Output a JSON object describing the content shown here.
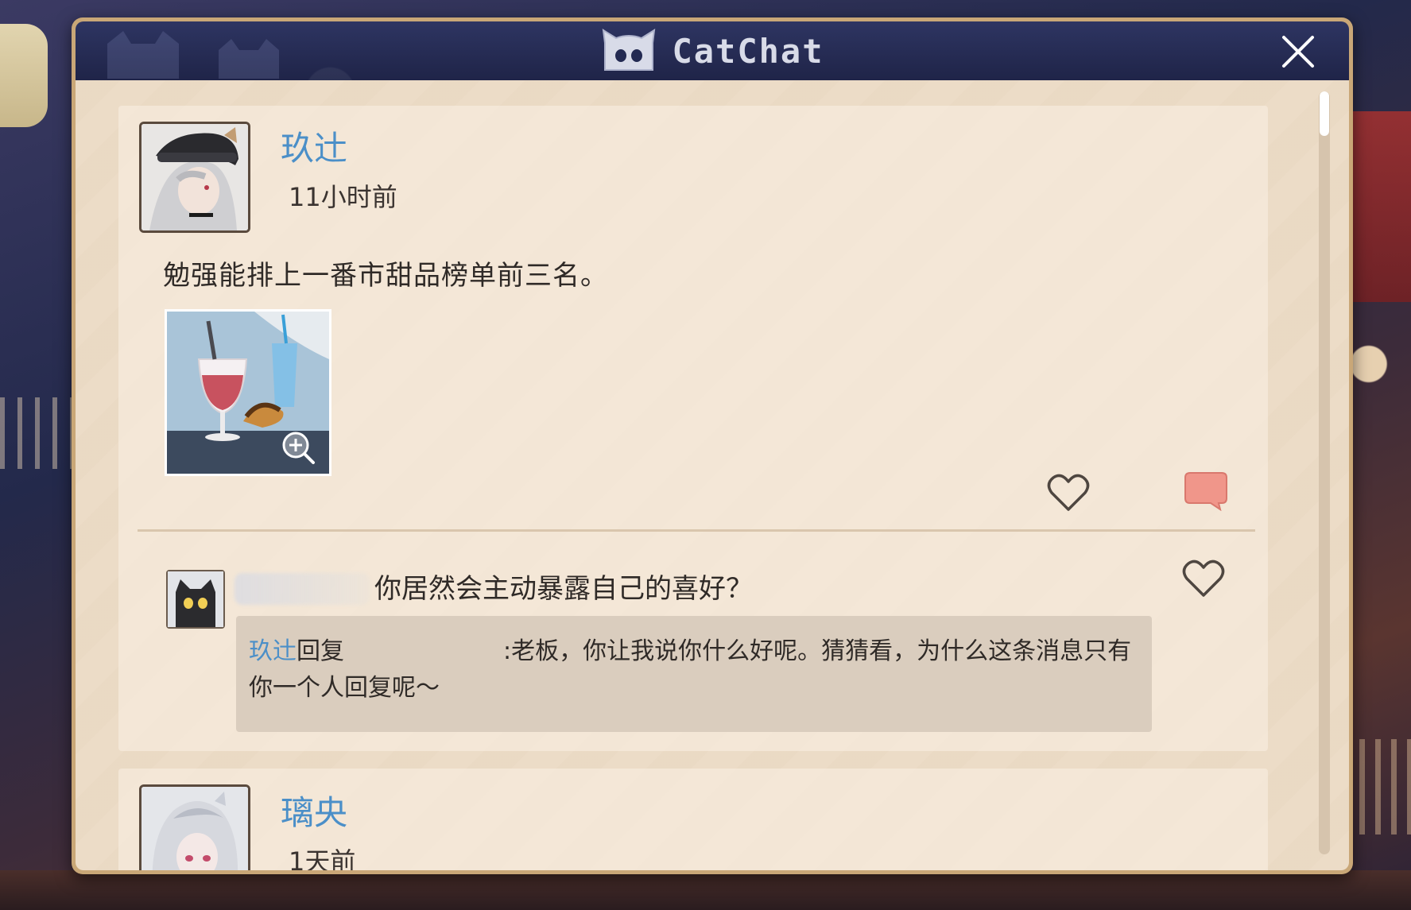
{
  "window": {
    "title": "CatChat"
  },
  "colors": {
    "header_bg": "#1f2448",
    "username": "#4b8fc8",
    "content_bg": "#ecdcc7",
    "comment_button": "#f0968a"
  },
  "icons": {
    "logo": "cat-face-icon",
    "close": "close-icon",
    "like": "heart-icon",
    "comment": "speech-bubble-icon",
    "zoom": "zoom-in-icon"
  },
  "posts": [
    {
      "author": "玖辻",
      "time": "11小时前",
      "text": "勉强能排上一番市甜品榜单前三名。",
      "comments": [
        {
          "text": "你居然会主动暴露自己的喜好？",
          "reply": {
            "author": "玖辻",
            "verb": "回复",
            "separator": ":",
            "text": "老板，你让我说你什么好呢。猜猜看，为什么这条消息只有你一个人回复呢～"
          }
        }
      ]
    },
    {
      "author": "璃央",
      "time": "1天前"
    }
  ]
}
